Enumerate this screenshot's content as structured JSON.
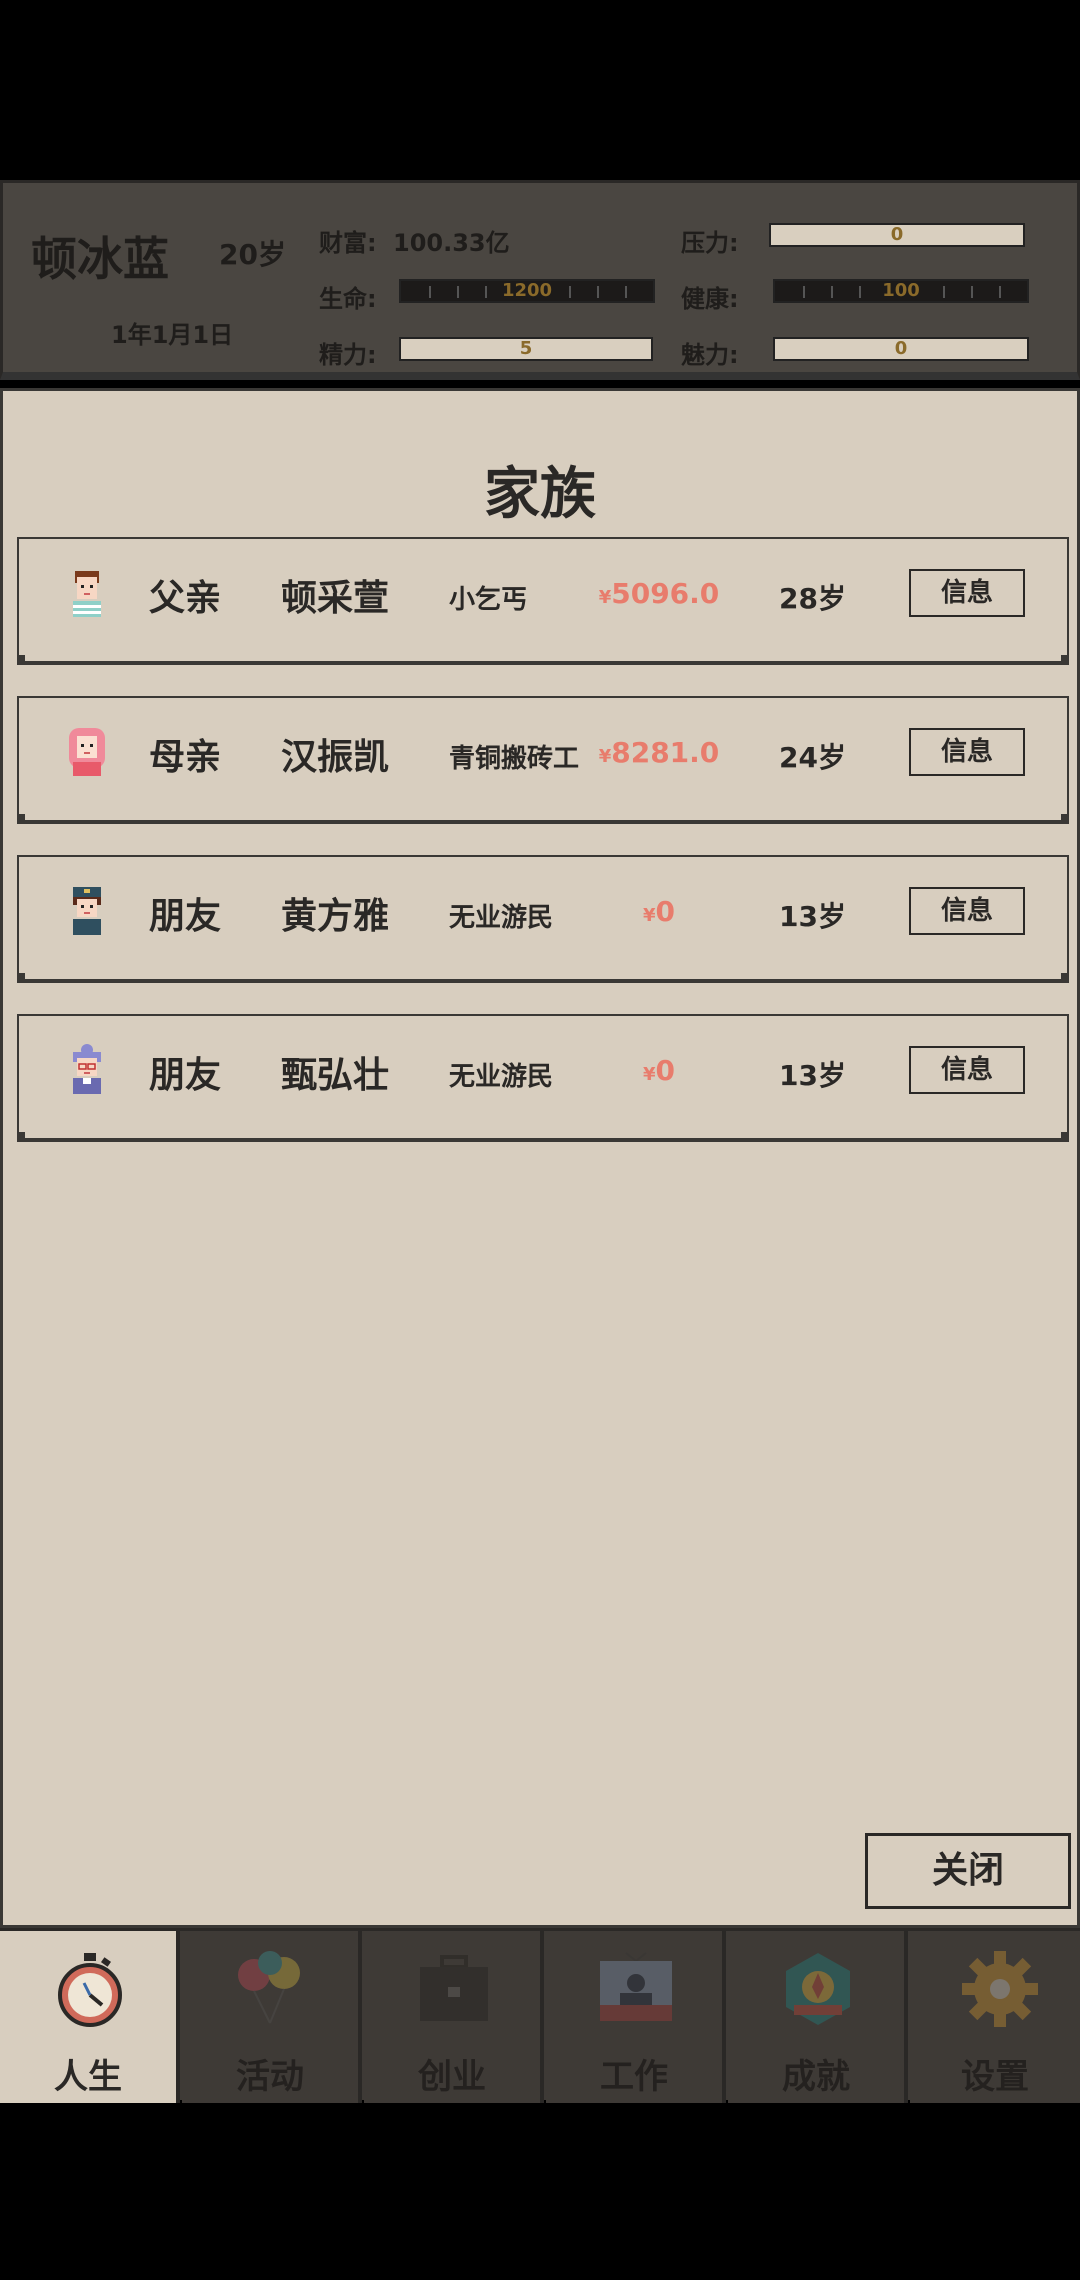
{
  "status": {
    "name": "顿冰蓝",
    "age": "20岁",
    "date": "1年1月1日",
    "wealth_label": "财富:",
    "wealth_value": "100.33亿",
    "life_label": "生命:",
    "life_value": "1200",
    "energy_label": "精力:",
    "energy_value": "5",
    "pressure_label": "压力:",
    "pressure_value": "0",
    "health_label": "健康:",
    "health_value": "100",
    "charm_label": "魅力:",
    "charm_value": "0"
  },
  "panel": {
    "title": "家族",
    "close_label": "关闭",
    "info_label": "信息",
    "rows": [
      {
        "relation": "父亲",
        "name": "顿采萱",
        "job": "小乞丐",
        "currency": "¥",
        "money": "5096.0",
        "age": "28岁",
        "avatar": "boy-avatar-icon"
      },
      {
        "relation": "母亲",
        "name": "汉振凯",
        "job": "青铜搬砖工",
        "currency": "¥",
        "money": "8281.0",
        "age": "24岁",
        "avatar": "pink-hair-girl-avatar-icon"
      },
      {
        "relation": "朋友",
        "name": "黄方雅",
        "job": "无业游民",
        "currency": "¥",
        "money": "0",
        "age": "13岁",
        "avatar": "police-avatar-icon"
      },
      {
        "relation": "朋友",
        "name": "甄弘壮",
        "job": "无业游民",
        "currency": "¥",
        "money": "0",
        "age": "13岁",
        "avatar": "grandma-avatar-icon"
      }
    ]
  },
  "nav": {
    "tabs": [
      {
        "label": "人生",
        "icon": "stopwatch-icon",
        "active": true
      },
      {
        "label": "活动",
        "icon": "balloons-icon",
        "active": false
      },
      {
        "label": "创业",
        "icon": "briefcase-icon",
        "active": false
      },
      {
        "label": "工作",
        "icon": "tv-presenter-icon",
        "active": false
      },
      {
        "label": "成就",
        "icon": "badge-icon",
        "active": false
      },
      {
        "label": "设置",
        "icon": "gear-icon",
        "active": false
      }
    ]
  }
}
